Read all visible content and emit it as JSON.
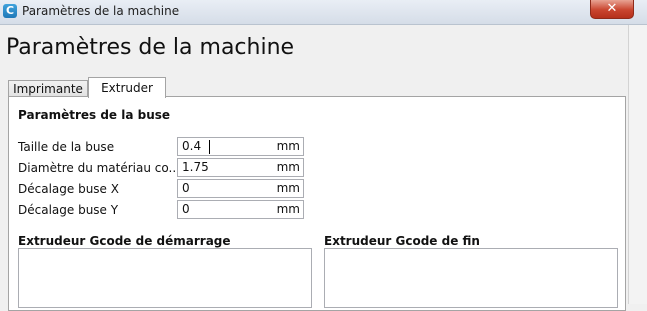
{
  "window": {
    "title": "Paramètres de la machine",
    "app_icon_letter": "C",
    "close_glyph": "✕"
  },
  "page_title": "Paramètres de la machine",
  "tabs": [
    {
      "label": "Imprimante",
      "active": false
    },
    {
      "label": "Extruder",
      "active": true
    }
  ],
  "nozzle_section": {
    "title": "Paramètres de la buse",
    "fields": [
      {
        "label": "Taille de la buse",
        "value": "0.4",
        "unit": "mm"
      },
      {
        "label": "Diamètre du matériau co...",
        "value": "1.75",
        "unit": "mm"
      },
      {
        "label": "Décalage buse X",
        "value": "0",
        "unit": "mm"
      },
      {
        "label": "Décalage buse Y",
        "value": "0",
        "unit": "mm"
      }
    ]
  },
  "gcode": {
    "start_title": "Extrudeur Gcode de démarrage",
    "start_value": "",
    "end_title": "Extrudeur Gcode de fin",
    "end_value": ""
  }
}
